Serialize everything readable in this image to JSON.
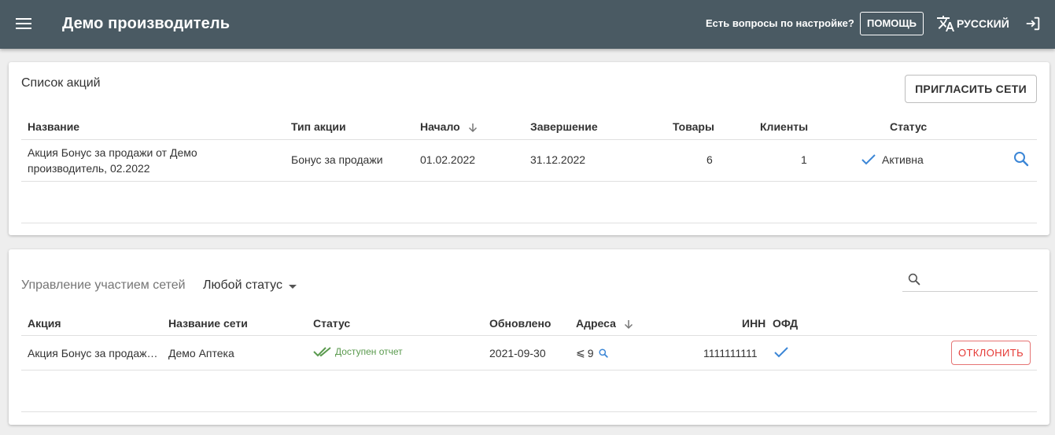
{
  "header": {
    "title": "Демо производитель",
    "help_question": "Есть вопросы по настройке?",
    "help_button": "ПОМОЩЬ",
    "language": "РУССКИЙ"
  },
  "promotions": {
    "title": "Список акций",
    "invite_button": "ПРИГЛАСИТЬ СЕТИ",
    "columns": {
      "name": "Название",
      "type": "Тип акции",
      "start": "Начало",
      "end": "Завершение",
      "products": "Товары",
      "clients": "Клиенты",
      "status": "Статус"
    },
    "rows": [
      {
        "name_line1": "Акция Бонус за продажи от Демо",
        "name_line2": "производитель, 02.2022",
        "type": "Бонус за продажи",
        "start": "01.02.2022",
        "end": "31.12.2022",
        "products": "6",
        "clients": "1",
        "status": "Активна"
      }
    ]
  },
  "participation": {
    "title": "Управление участием сетей",
    "status_filter": "Любой статус",
    "search_placeholder": "",
    "columns": {
      "promotion": "Акция",
      "network": "Название сети",
      "status": "Статус",
      "updated": "Обновлено",
      "addresses": "Адреса",
      "inn": "ИНН",
      "ofd": "ОФД"
    },
    "rows": [
      {
        "promotion": "Акция Бонус за продаж…",
        "network": "Демо Аптека",
        "status": "Доступен отчет",
        "updated": "2021-09-30",
        "addresses_prefix": "⩽",
        "addresses": "9",
        "inn": "1111111111",
        "action": "ОТКЛОНИТЬ"
      }
    ]
  },
  "colors": {
    "appbar": "#4a5a63",
    "accent_blue": "#3b86d6",
    "success_green": "#5a9a4e",
    "danger_red": "#e53935"
  }
}
